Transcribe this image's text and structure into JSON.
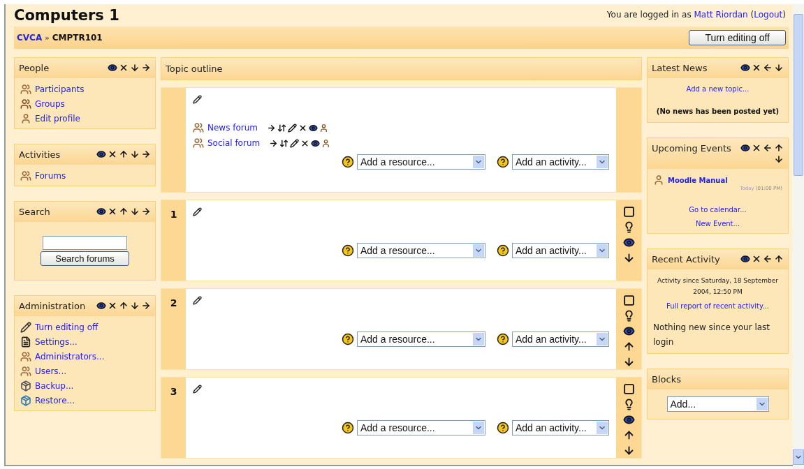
{
  "header": {
    "title": "Computers 1",
    "login": [
      {
        "kind": "text",
        "text": "You are logged in as "
      },
      {
        "kind": "link",
        "text": "Matt Riordan"
      },
      {
        "kind": "text",
        "text": " ("
      },
      {
        "kind": "link",
        "text": "Logout"
      },
      {
        "kind": "text",
        "text": ")"
      }
    ]
  },
  "navbar": {
    "breadcrumb": [
      {
        "kind": "link",
        "text": "CVCA"
      },
      {
        "kind": "separator",
        "text": "»"
      },
      {
        "kind": "current",
        "text": "CMPTR101"
      }
    ],
    "button": "Turn editing off"
  },
  "left_blocks": [
    {
      "title": "People",
      "controls": [
        {
          "kind": "hide"
        },
        {
          "kind": "delete"
        },
        {
          "kind": "down"
        },
        {
          "kind": "right"
        }
      ],
      "content": [
        {
          "kind": "people",
          "text": "Participants"
        },
        {
          "kind": "group",
          "text": "Groups"
        },
        {
          "kind": "person",
          "text": "Edit profile"
        }
      ]
    },
    {
      "title": "Activities",
      "controls": [
        {
          "kind": "hide"
        },
        {
          "kind": "delete"
        },
        {
          "kind": "up"
        },
        {
          "kind": "down"
        },
        {
          "kind": "right"
        }
      ],
      "content": [
        {
          "kind": "people",
          "text": "Forums"
        }
      ]
    },
    {
      "title": "Search",
      "controls": [
        {
          "kind": "hide"
        },
        {
          "kind": "delete"
        },
        {
          "kind": "up"
        },
        {
          "kind": "down"
        },
        {
          "kind": "right"
        }
      ],
      "content": [
        {
          "kind": "search",
          "button": "Search forums"
        }
      ]
    },
    {
      "title": "Administration",
      "controls": [
        {
          "kind": "hide"
        },
        {
          "kind": "delete"
        },
        {
          "kind": "up"
        },
        {
          "kind": "down"
        },
        {
          "kind": "right"
        }
      ],
      "content": [
        {
          "kind": "edit",
          "text": "Turn editing off"
        },
        {
          "kind": "settings",
          "text": "Settings..."
        },
        {
          "kind": "people",
          "text": "Administrators..."
        },
        {
          "kind": "people",
          "text": "Users..."
        },
        {
          "kind": "backup",
          "text": "Backup..."
        },
        {
          "kind": "restore",
          "text": "Restore..."
        }
      ]
    }
  ],
  "topics": {
    "title": "Topic outline",
    "sections": [
      {
        "activities": [
          {
            "text": "News forum",
            "controls": [
              {
                "kind": "right"
              },
              {
                "kind": "move"
              },
              {
                "kind": "edit"
              },
              {
                "kind": "delete"
              },
              {
                "kind": "hide"
              },
              {
                "kind": "role"
              }
            ]
          },
          {
            "text": "Social forum",
            "controls": [
              {
                "kind": "right"
              },
              {
                "kind": "move"
              },
              {
                "kind": "edit"
              },
              {
                "kind": "delete"
              },
              {
                "kind": "hide"
              },
              {
                "kind": "role"
              }
            ]
          }
        ],
        "resource": "Add a resource...",
        "activity": "Add an activity..."
      },
      {
        "number": "1",
        "resource": "Add a resource...",
        "activity": "Add an activity...",
        "side": [
          {
            "kind": "highlight"
          },
          {
            "kind": "marker"
          },
          {
            "kind": "hide"
          },
          {
            "kind": "down"
          }
        ]
      },
      {
        "number": "2",
        "resource": "Add a resource...",
        "activity": "Add an activity...",
        "side": [
          {
            "kind": "highlight"
          },
          {
            "kind": "marker"
          },
          {
            "kind": "hide"
          },
          {
            "kind": "up"
          },
          {
            "kind": "down"
          }
        ]
      },
      {
        "number": "3",
        "resource": "Add a resource...",
        "activity": "Add an activity...",
        "side": [
          {
            "kind": "highlight"
          },
          {
            "kind": "marker"
          },
          {
            "kind": "hide"
          },
          {
            "kind": "up"
          },
          {
            "kind": "down"
          }
        ]
      }
    ]
  },
  "right_blocks": [
    {
      "title": "Latest News",
      "controls": [
        {
          "kind": "hide"
        },
        {
          "kind": "delete"
        },
        {
          "kind": "left"
        },
        {
          "kind": "down"
        }
      ],
      "content": [
        {
          "kind": "link",
          "text": "Add a new topic..."
        },
        {
          "kind": "strong",
          "text": "(No news has been posted yet)"
        }
      ]
    },
    {
      "title": "Upcoming Events",
      "controls": [
        {
          "kind": "hide"
        },
        {
          "kind": "delete"
        },
        {
          "kind": "left"
        },
        {
          "kind": "up"
        },
        {
          "kind": "down"
        }
      ],
      "content": [
        {
          "kind": "event",
          "text": "Moodle Manual",
          "day": "Today",
          "time": "(01:00 PM)"
        },
        {
          "kind": "link",
          "text": "Go to calendar..."
        },
        {
          "kind": "link",
          "text": "New Event..."
        }
      ]
    },
    {
      "title": "Recent Activity",
      "controls": [
        {
          "kind": "hide"
        },
        {
          "kind": "delete"
        },
        {
          "kind": "left"
        },
        {
          "kind": "up"
        }
      ],
      "content": [
        {
          "kind": "note",
          "text": "Activity since Saturday, 18 September 2004, 12:50 PM"
        },
        {
          "kind": "link",
          "text": "Full report of recent activity..."
        },
        {
          "kind": "text",
          "text": "Nothing new since your last login"
        }
      ]
    },
    {
      "title": "Blocks",
      "content": [
        {
          "kind": "select",
          "text": "Add..."
        }
      ]
    }
  ]
}
